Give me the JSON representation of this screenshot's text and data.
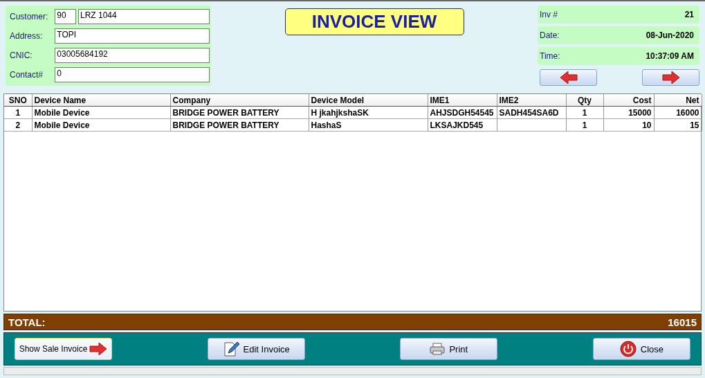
{
  "customer": {
    "label": "Customer:",
    "code": "90",
    "name": "LRZ 1044"
  },
  "fields": [
    {
      "label": "Address:",
      "value": "TOPI"
    },
    {
      "label": "CNIC:",
      "value": "03005684192"
    },
    {
      "label": "Contact#",
      "value": "0"
    }
  ],
  "title": "INVOICE VIEW",
  "info": [
    {
      "label": "Inv #",
      "value": "21"
    },
    {
      "label": "Date:",
      "value": "08-Jun-2020"
    },
    {
      "label": "Time:",
      "value": "10:37:09 AM"
    }
  ],
  "table": {
    "columns": [
      "SNO",
      "Device Name",
      "Company",
      "Device Model",
      "IME1",
      "IME2",
      "Qty",
      "Cost",
      "Net"
    ],
    "rows": [
      [
        "1",
        "Mobile Device",
        "BRIDGE POWER BATTERY",
        "H jkahjkshaSK",
        "AHJSDGH54545",
        "SADH454SA6D",
        "1",
        "15000",
        "16000"
      ],
      [
        "2",
        "Mobile Device",
        "BRIDGE POWER BATTERY",
        "HashaS",
        "LKSAJKD545",
        "",
        "1",
        "10",
        "15"
      ]
    ]
  },
  "total": {
    "label": "TOTAL:",
    "value": "16015"
  },
  "buttons": [
    {
      "label": "Show Sale Invoice",
      "kind": "arrow"
    },
    {
      "label": "Edit Invoice",
      "kind": "edit"
    },
    {
      "label": "Print",
      "kind": "print"
    },
    {
      "label": "Close",
      "kind": "power"
    }
  ]
}
